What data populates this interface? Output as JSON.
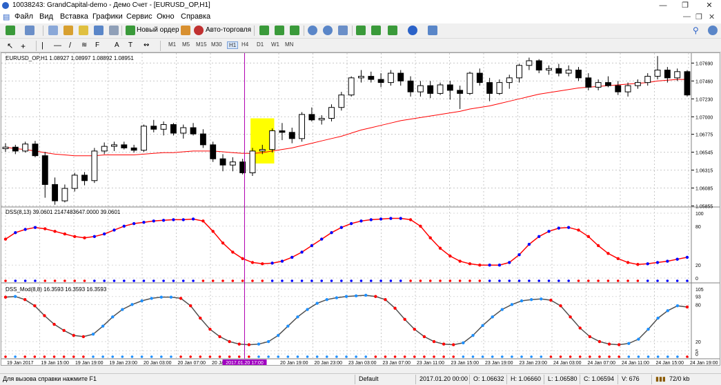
{
  "window": {
    "title": "10038243: GrandCapital-demo - Демо Счет - [EURUSD_OP,H1]"
  },
  "menu": [
    "Файл",
    "Вид",
    "Вставка",
    "Графики",
    "Сервис",
    "Окно",
    "Справка"
  ],
  "toolbar": {
    "new_order_label": "Новый ордер",
    "auto_trading_label": "Авто-торговля",
    "timeframes": [
      "M1",
      "M5",
      "M15",
      "M30",
      "H1",
      "H4",
      "D1",
      "W1",
      "MN"
    ]
  },
  "chart": {
    "header": "EURUSD_OP,H1  1.08927 1.08997 1.08892 1.08951",
    "indicator1_label": "DSS(8,13) 39.0601 2147483647.0000 39.0601",
    "indicator2_label": "DSS_Mod(8,8) 16.3593 16.3593 16.3593",
    "price_ticks": [
      "1.07690",
      "1.07460",
      "1.07230",
      "1.07000",
      "1.06775",
      "1.06545",
      "1.06315",
      "1.06085",
      "1.05855"
    ],
    "ind1_ticks": [
      "100",
      "80",
      "20",
      "0"
    ],
    "ind2_ticks": [
      "105",
      "93",
      "80",
      "20",
      "5",
      "0"
    ],
    "time_ticks": [
      "19 Jan 2017",
      "19 Jan 15:00",
      "19 Jan 19:00",
      "19 Jan 23:00",
      "20 Jan 03:00",
      "20 Jan 07:00",
      "20 Jan 11:00",
      "2017.01.20 17:00",
      "20 Jan 19:00",
      "20 Jan 23:00",
      "23 Jan 03:00",
      "23 Jan 07:00",
      "23 Jan 11:00",
      "23 Jan 15:00",
      "23 Jan 19:00",
      "23 Jan 23:00",
      "24 Jan 03:00",
      "24 Jan 07:00",
      "24 Jan 11:00",
      "24 Jan 15:00",
      "24 Jan 19:00"
    ],
    "colors": {
      "ma": "#ff0000",
      "cursor": "#b000b0",
      "highlight": "#ffff00",
      "ind_up": "#0000ff",
      "ind_down": "#ff0000",
      "ind2_up": "#1e90ff",
      "ind2_line": "#505050",
      "cursor_label_bg": "#a000c0"
    }
  },
  "chart_data": [
    {
      "type": "candlestick",
      "title": "EURUSD_OP,H1",
      "ylim": [
        1.0585,
        1.078
      ],
      "ohlc": [
        [
          1.0659,
          1.0666,
          1.0655,
          1.0661
        ],
        [
          1.0661,
          1.0664,
          1.0652,
          1.0656
        ],
        [
          1.0656,
          1.0668,
          1.0654,
          1.0665
        ],
        [
          1.0665,
          1.0669,
          1.0648,
          1.065
        ],
        [
          1.065,
          1.0655,
          1.0596,
          1.0613
        ],
        [
          1.0613,
          1.0622,
          1.0587,
          1.0592
        ],
        [
          1.0592,
          1.0613,
          1.059,
          1.0608
        ],
        [
          1.0608,
          1.0628,
          1.0604,
          1.0625
        ],
        [
          1.0625,
          1.0629,
          1.0612,
          1.0618
        ],
        [
          1.0618,
          1.066,
          1.0615,
          1.0656
        ],
        [
          1.0656,
          1.0667,
          1.0652,
          1.0662
        ],
        [
          1.0662,
          1.0668,
          1.0656,
          1.0664
        ],
        [
          1.0664,
          1.0668,
          1.0658,
          1.066
        ],
        [
          1.066,
          1.0664,
          1.0654,
          1.0657
        ],
        [
          1.0657,
          1.069,
          1.0655,
          1.0688
        ],
        [
          1.0688,
          1.0696,
          1.068,
          1.0684
        ],
        [
          1.0684,
          1.0694,
          1.0676,
          1.069
        ],
        [
          1.069,
          1.0692,
          1.0676,
          1.0679
        ],
        [
          1.0679,
          1.069,
          1.0672,
          1.0686
        ],
        [
          1.0686,
          1.0692,
          1.0676,
          1.0678
        ],
        [
          1.0678,
          1.0684,
          1.066,
          1.0664
        ],
        [
          1.0664,
          1.0668,
          1.0642,
          1.0646
        ],
        [
          1.0646,
          1.0652,
          1.063,
          1.0638
        ],
        [
          1.0638,
          1.0648,
          1.063,
          1.0642
        ],
        [
          1.0642,
          1.0646,
          1.0626,
          1.0628
        ],
        [
          1.0628,
          1.066,
          1.0624,
          1.0656
        ],
        [
          1.0656,
          1.0664,
          1.0652,
          1.0658
        ],
        [
          1.0658,
          1.0685,
          1.0654,
          1.0682
        ],
        [
          1.0682,
          1.0692,
          1.067,
          1.068
        ],
        [
          1.068,
          1.0686,
          1.0666,
          1.0672
        ],
        [
          1.0672,
          1.0706,
          1.0668,
          1.0703
        ],
        [
          1.0703,
          1.0712,
          1.0694,
          1.0696
        ],
        [
          1.0696,
          1.0702,
          1.069,
          1.0698
        ],
        [
          1.0698,
          1.0716,
          1.0694,
          1.0712
        ],
        [
          1.0712,
          1.0732,
          1.0708,
          1.0728
        ],
        [
          1.0728,
          1.0752,
          1.0726,
          1.075
        ],
        [
          1.075,
          1.076,
          1.0744,
          1.0752
        ],
        [
          1.0752,
          1.0758,
          1.0744,
          1.0748
        ],
        [
          1.0748,
          1.0756,
          1.0738,
          1.0744
        ],
        [
          1.0744,
          1.076,
          1.074,
          1.0756
        ],
        [
          1.0756,
          1.076,
          1.074,
          1.0746
        ],
        [
          1.0746,
          1.0752,
          1.0726,
          1.0732
        ],
        [
          1.0732,
          1.0746,
          1.0726,
          1.074
        ],
        [
          1.074,
          1.0746,
          1.0724,
          1.073
        ],
        [
          1.073,
          1.0744,
          1.0728,
          1.0741
        ],
        [
          1.0741,
          1.0746,
          1.0722,
          1.0734
        ],
        [
          1.0734,
          1.074,
          1.071,
          1.073
        ],
        [
          1.073,
          1.0758,
          1.0728,
          1.0756
        ],
        [
          1.0756,
          1.0762,
          1.074,
          1.0744
        ],
        [
          1.0744,
          1.075,
          1.072,
          1.073
        ],
        [
          1.073,
          1.0748,
          1.0728,
          1.0744
        ],
        [
          1.0744,
          1.0754,
          1.0736,
          1.075
        ],
        [
          1.075,
          1.0768,
          1.0744,
          1.0766
        ],
        [
          1.0766,
          1.0776,
          1.076,
          1.0772
        ],
        [
          1.0772,
          1.0774,
          1.0756,
          1.076
        ],
        [
          1.076,
          1.0766,
          1.0754,
          1.0762
        ],
        [
          1.0762,
          1.0768,
          1.0752,
          1.0756
        ],
        [
          1.0756,
          1.0766,
          1.0752,
          1.076
        ],
        [
          1.076,
          1.0764,
          1.0746,
          1.075
        ],
        [
          1.075,
          1.0756,
          1.0734,
          1.0738
        ],
        [
          1.0738,
          1.0748,
          1.0734,
          1.0744
        ],
        [
          1.0744,
          1.0752,
          1.0738,
          1.074
        ],
        [
          1.074,
          1.0746,
          1.0728,
          1.0732
        ],
        [
          1.0732,
          1.0744,
          1.0726,
          1.074
        ],
        [
          1.074,
          1.0748,
          1.0736,
          1.0744
        ],
        [
          1.0744,
          1.0756,
          1.074,
          1.0752
        ],
        [
          1.0752,
          1.0778,
          1.0748,
          1.076
        ],
        [
          1.076,
          1.0764,
          1.0744,
          1.075
        ],
        [
          1.075,
          1.0762,
          1.0746,
          1.0758
        ],
        [
          1.0758,
          1.076,
          1.0726,
          1.0728
        ]
      ],
      "ma": [
        1.0661,
        1.0659,
        1.0658,
        1.0656,
        1.0654,
        1.0652,
        1.0651,
        1.065,
        1.065,
        1.065,
        1.0651,
        1.0651,
        1.0651,
        1.0651,
        1.0652,
        1.0653,
        1.0654,
        1.0654,
        1.0655,
        1.0656,
        1.0656,
        1.0656,
        1.0655,
        1.0654,
        1.0653,
        1.0653,
        1.0654,
        1.0656,
        1.0658,
        1.066,
        1.0663,
        1.0666,
        1.0669,
        1.0672,
        1.0675,
        1.0679,
        1.0683,
        1.0686,
        1.0689,
        1.0692,
        1.0695,
        1.0697,
        1.0699,
        1.0701,
        1.0703,
        1.0705,
        1.0707,
        1.071,
        1.0712,
        1.0714,
        1.0717,
        1.072,
        1.0723,
        1.0726,
        1.0729,
        1.0731,
        1.0733,
        1.0735,
        1.0737,
        1.0738,
        1.0739,
        1.074,
        1.0741,
        1.0742,
        1.0743,
        1.0744,
        1.0746,
        1.0747,
        1.0748,
        1.0748
      ]
    },
    {
      "type": "line",
      "title": "DSS(8,13)",
      "ylim": [
        0,
        100
      ],
      "values": [
        60,
        70,
        75,
        78,
        76,
        72,
        68,
        64,
        62,
        64,
        68,
        74,
        80,
        84,
        86,
        88,
        89,
        90,
        90,
        91,
        88,
        72,
        54,
        40,
        30,
        24,
        22,
        23,
        26,
        32,
        40,
        50,
        60,
        70,
        78,
        84,
        88,
        90,
        91,
        92,
        92,
        90,
        80,
        62,
        46,
        34,
        26,
        22,
        20,
        20,
        20,
        24,
        36,
        52,
        64,
        72,
        77,
        78,
        74,
        64,
        50,
        38,
        30,
        24,
        21,
        22,
        24,
        26,
        29,
        32
      ]
    },
    {
      "type": "line",
      "title": "DSS_Mod(8,8)",
      "ylim": [
        0,
        105
      ],
      "values": [
        92,
        93,
        88,
        78,
        62,
        48,
        38,
        30,
        28,
        32,
        45,
        60,
        72,
        80,
        86,
        90,
        92,
        92,
        90,
        78,
        58,
        40,
        28,
        20,
        16,
        15,
        16,
        20,
        30,
        45,
        60,
        72,
        82,
        88,
        91,
        93,
        94,
        95,
        93,
        88,
        74,
        56,
        40,
        28,
        20,
        16,
        15,
        18,
        30,
        46,
        60,
        72,
        80,
        86,
        88,
        89,
        87,
        78,
        60,
        42,
        28,
        20,
        16,
        15,
        17,
        24,
        40,
        58,
        70,
        78,
        76
      ]
    }
  ],
  "status": {
    "help_text": "Для вызова справки нажмите F1",
    "profile": "Default",
    "datetime": "2017.01.20 00:00",
    "open": "O: 1.06632",
    "high": "H: 1.06660",
    "low": "L: 1.06580",
    "close": "C: 1.06594",
    "volume": "V: 676",
    "traffic": "72/0 kb"
  }
}
